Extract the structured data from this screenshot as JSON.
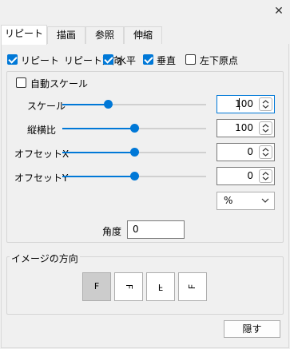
{
  "window": {
    "close_glyph": "✕",
    "close_icon": "close-icon"
  },
  "tabs": [
    {
      "label": "リピート",
      "active": true
    },
    {
      "label": "描画",
      "active": false
    },
    {
      "label": "参照",
      "active": false
    },
    {
      "label": "伸縮",
      "active": false
    }
  ],
  "repeat": {
    "repeat_label": "リピート",
    "direction_label": "リピート方向",
    "horizontal_label": "水平",
    "vertical_label": "垂直",
    "origin_label": "左下原点",
    "repeat_checked": true,
    "horizontal_checked": true,
    "vertical_checked": true,
    "origin_checked": false
  },
  "scale_group": {
    "auto_scale_label": "自動スケール",
    "auto_scale_checked": false,
    "rows": [
      {
        "label": "スケール",
        "value": "100",
        "slider_fraction": 0.33
      },
      {
        "label": "縦横比",
        "value": "100",
        "slider_fraction": 0.5
      },
      {
        "label": "オフセットX",
        "value": "0",
        "slider_fraction": 0.5
      },
      {
        "label": "オフセットY",
        "value": "0",
        "slider_fraction": 0.5
      }
    ],
    "unit_select": "%",
    "angle_label": "角度",
    "angle_value": "0"
  },
  "orientation": {
    "title": "イメージの方向",
    "buttons": [
      {
        "glyph": "F",
        "selected": true
      },
      {
        "glyph": "F",
        "selected": false
      },
      {
        "glyph": "F",
        "selected": false
      },
      {
        "glyph": "F",
        "selected": false
      }
    ]
  },
  "footer": {
    "hide_label": "隠す"
  },
  "colors": {
    "accent": "#0078d7",
    "background": "#f0f0f0"
  }
}
